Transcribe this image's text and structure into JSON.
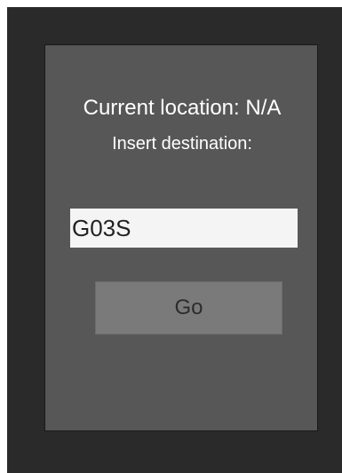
{
  "location": {
    "text": "Current location: N/A"
  },
  "destination": {
    "prompt": "Insert destination:",
    "value": "G03S"
  },
  "go_button": {
    "label": "Go"
  },
  "colors": {
    "background": "#2a2a2a",
    "panel": "#575757",
    "input": "#f4f4f4",
    "button": "#7a7a7a",
    "text": "#ffffff"
  }
}
